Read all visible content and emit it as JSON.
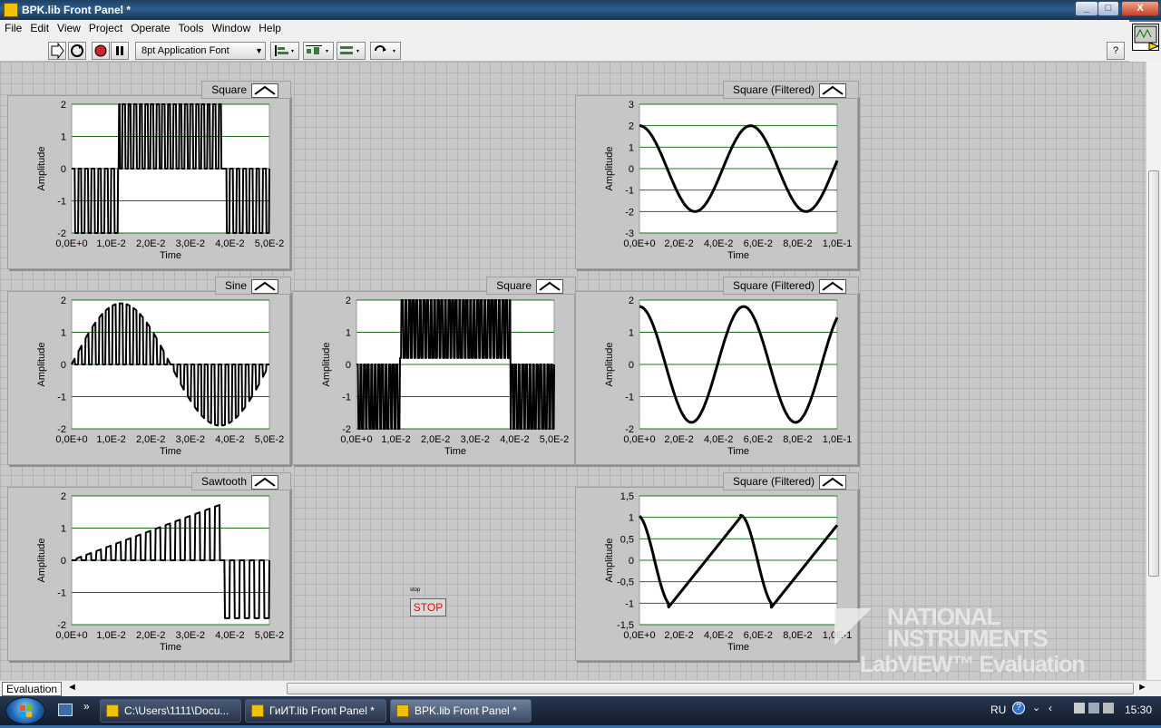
{
  "window": {
    "title": "BPK.lib Front Panel *",
    "min": "_",
    "max": "□",
    "close": "X"
  },
  "menu": [
    "File",
    "Edit",
    "View",
    "Project",
    "Operate",
    "Tools",
    "Window",
    "Help"
  ],
  "toolbar": {
    "font": "8pt Application Font",
    "help": "?"
  },
  "graphs": [
    {
      "id": "g1",
      "label": "Square",
      "ylabel": "Amplitude",
      "xlabel": "Time",
      "yticks": [
        "2",
        "1",
        "0",
        "-1",
        "-2"
      ],
      "xticks": [
        "0,0E+0",
        "1,0E-2",
        "2,0E-2",
        "3,0E-2",
        "4,0E-2",
        "5,0E-2"
      ]
    },
    {
      "id": "g2",
      "label": "Square (Filtered)",
      "ylabel": "Amplitude",
      "xlabel": "Time",
      "yticks": [
        "3",
        "2",
        "1",
        "0",
        "-1",
        "-2",
        "-3"
      ],
      "xticks": [
        "0,0E+0",
        "2,0E-2",
        "4,0E-2",
        "6,0E-2",
        "8,0E-2",
        "1,0E-1"
      ]
    },
    {
      "id": "g3",
      "label": "Sine",
      "ylabel": "Amplitude",
      "xlabel": "Time",
      "yticks": [
        "2",
        "1",
        "0",
        "-1",
        "-2"
      ],
      "xticks": [
        "0,0E+0",
        "1,0E-2",
        "2,0E-2",
        "3,0E-2",
        "4,0E-2",
        "5,0E-2"
      ]
    },
    {
      "id": "g4",
      "label": "Square",
      "ylabel": "Amplitude",
      "xlabel": "Time",
      "yticks": [
        "2",
        "1",
        "0",
        "-1",
        "-2"
      ],
      "xticks": [
        "0,0E+0",
        "1,0E-2",
        "2,0E-2",
        "3,0E-2",
        "4,0E-2",
        "5,0E-2"
      ]
    },
    {
      "id": "g5",
      "label": "Square (Filtered)",
      "ylabel": "Amplitude",
      "xlabel": "Time",
      "yticks": [
        "2",
        "1",
        "0",
        "-1",
        "-2"
      ],
      "xticks": [
        "0,0E+0",
        "2,0E-2",
        "4,0E-2",
        "6,0E-2",
        "8,0E-2",
        "1,0E-1"
      ]
    },
    {
      "id": "g6",
      "label": "Sawtooth",
      "ylabel": "Amplitude",
      "xlabel": "Time",
      "yticks": [
        "2",
        "1",
        "0",
        "-1",
        "-2"
      ],
      "xticks": [
        "0,0E+0",
        "1,0E-2",
        "2,0E-2",
        "3,0E-2",
        "4,0E-2",
        "5,0E-2"
      ]
    },
    {
      "id": "g7",
      "label": "Square (Filtered)",
      "ylabel": "Amplitude",
      "xlabel": "Time",
      "yticks": [
        "1,5",
        "1",
        "0,5",
        "0",
        "-0,5",
        "-1",
        "-1,5"
      ],
      "xticks": [
        "0,0E+0",
        "2,0E-2",
        "4,0E-2",
        "6,0E-2",
        "8,0E-2",
        "1,0E-1"
      ]
    }
  ],
  "stop": {
    "label": "stop",
    "button": "STOP"
  },
  "watermark": {
    "line1": "NATIONAL",
    "line2": "INSTRUMENTS",
    "line3": "LabVIEW™ Evaluation Software"
  },
  "statusbar": {
    "context": "Evaluation"
  },
  "taskbar": {
    "tasks": [
      "C:\\Users\\1111\\Docu...",
      "ГиИТ.lib Front Panel *",
      "BPK.lib Front Panel *"
    ],
    "lang": "RU",
    "clock": "15:30"
  },
  "colors": {
    "grid": "#1a7a1a",
    "plot": "#000000",
    "panel": "#c8c8c8"
  }
}
